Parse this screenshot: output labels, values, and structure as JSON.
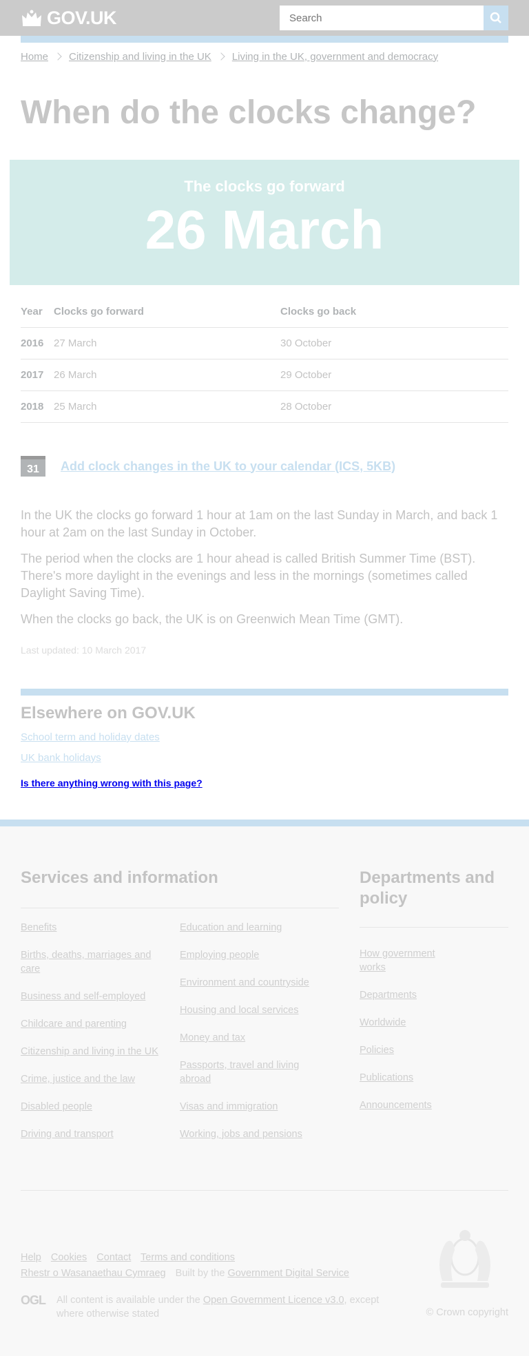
{
  "header": {
    "logo_text": "GOV.UK",
    "search_placeholder": "Search",
    "brand_color": "#0b0c0c",
    "accent_color": "#1d70b8"
  },
  "breadcrumbs": [
    "Home",
    "Citizenship and living in the UK",
    "Living in the UK, government and democracy"
  ],
  "page_title": "When do the clocks change?",
  "hero": {
    "subtitle": "The clocks go forward",
    "date": "26 March"
  },
  "table": {
    "headers": [
      "Year",
      "Clocks go forward",
      "Clocks go back"
    ],
    "rows": [
      [
        "2016",
        "27 March",
        "30 October"
      ],
      [
        "2017",
        "26 March",
        "29 October"
      ],
      [
        "2018",
        "25 March",
        "28 October"
      ]
    ]
  },
  "calendar": {
    "icon_day": "31",
    "link_text": "Add clock changes in the UK to your calendar (ICS, 5KB)"
  },
  "body": [
    "In the UK the clocks go forward 1 hour at 1am on the last Sunday in March, and back 1 hour at 2am on the last Sunday in October.",
    "The period when the clocks are 1 hour ahead is called British Summer Time (BST). There's more daylight in the evenings and less in the mornings (sometimes called Daylight Saving Time).",
    "When the clocks go back, the UK is on Greenwich Mean Time (GMT)."
  ],
  "last_updated": "Last updated: 10 March 2017",
  "related": {
    "title": "Elsewhere on GOV.UK",
    "links": [
      "School term and holiday dates",
      "UK bank holidays"
    ]
  },
  "feedback": "Is there anything wrong with this page?",
  "footer": {
    "services_title": "Services and information",
    "services_col1": [
      "Benefits",
      "Births, deaths, marriages and care",
      "Business and self-employed",
      "Childcare and parenting",
      "Citizenship and living in the UK",
      "Crime, justice and the law",
      "Disabled people",
      "Driving and transport"
    ],
    "services_col2": [
      "Education and learning",
      "Employing people",
      "Environment and countryside",
      "Housing and local services",
      "Money and tax",
      "Passports, travel and living abroad",
      "Visas and immigration",
      "Working, jobs and pensions"
    ],
    "departments_title": "Departments and policy",
    "departments": [
      "How government works",
      "Departments",
      "Worldwide",
      "Policies",
      "Publications",
      "Announcements"
    ],
    "meta_links": [
      "Help",
      "Cookies",
      "Contact",
      "Terms and conditions"
    ],
    "meta_welsh": "Rhestr o Wasanaethau Cymraeg",
    "built_by_prefix": "Built by the",
    "built_by_link": "Government Digital Service",
    "ogl": "OGL",
    "licence_prefix": "All content is available under the",
    "licence_link": "Open Government Licence v3.0",
    "licence_suffix": ", except where otherwise stated",
    "copyright": "© Crown copyright"
  }
}
